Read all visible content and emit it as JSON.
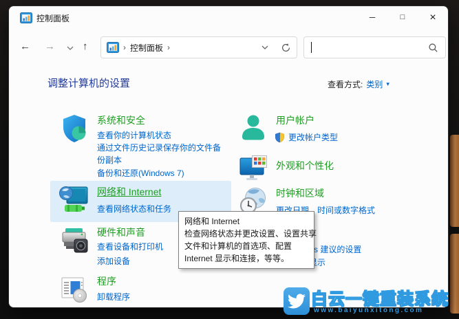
{
  "colors": {
    "category_green": "#1e9e22",
    "link_blue": "#0066cc",
    "header_blue": "#21399a",
    "hover_highlight": "#ddeefa",
    "wallpaper_accent": "#cf8a4c",
    "watermark_blue": "#2f9ae0"
  },
  "window": {
    "title": "控制面板"
  },
  "titlebar_controls": {
    "minimize": "─",
    "maximize": "□",
    "close": "×"
  },
  "navbar": {
    "back": "←",
    "forward": "→",
    "up": "↑",
    "breadcrumb_sep": "›",
    "breadcrumb_root": "控制面板",
    "search_value": ""
  },
  "header": {
    "title": "调整计算机的设置",
    "view_by_label": "查看方式:",
    "view_by_value": "类别",
    "dropdown_glyph": "▾"
  },
  "categories": {
    "left": [
      {
        "title": "系统和安全",
        "links": [
          "查看你的计算机状态",
          "通过文件历史记录保存你的文件备份副本",
          "备份和还原(Windows 7)"
        ]
      },
      {
        "title": "网络和 Internet",
        "hovered": true,
        "links": [
          "查看网络状态和任务"
        ]
      },
      {
        "title": "硬件和声音",
        "links": [
          "查看设备和打印机",
          "添加设备"
        ]
      },
      {
        "title": "程序",
        "links": [
          "卸载程序"
        ]
      }
    ],
    "right": [
      {
        "title": "用户帐户",
        "links": [
          "更改帐户类型"
        ]
      },
      {
        "title": "外观和个性化",
        "links": []
      },
      {
        "title": "时钟和区域",
        "links": [
          "更改日期、时间或数字格式"
        ]
      },
      {
        "title": "",
        "links": [
          "让 Windows 建议的设置",
          "优化视觉显示"
        ]
      }
    ]
  },
  "tooltip": {
    "title": "网络和 Internet",
    "lines": [
      "检查网络状态并更改设置、设置共享",
      "文件和计算机的首选项、配置",
      "Internet 显示和连接，等等。"
    ]
  },
  "watermark": {
    "title": "白云一键重装系统",
    "url": "www.baiyunxitong.com"
  }
}
